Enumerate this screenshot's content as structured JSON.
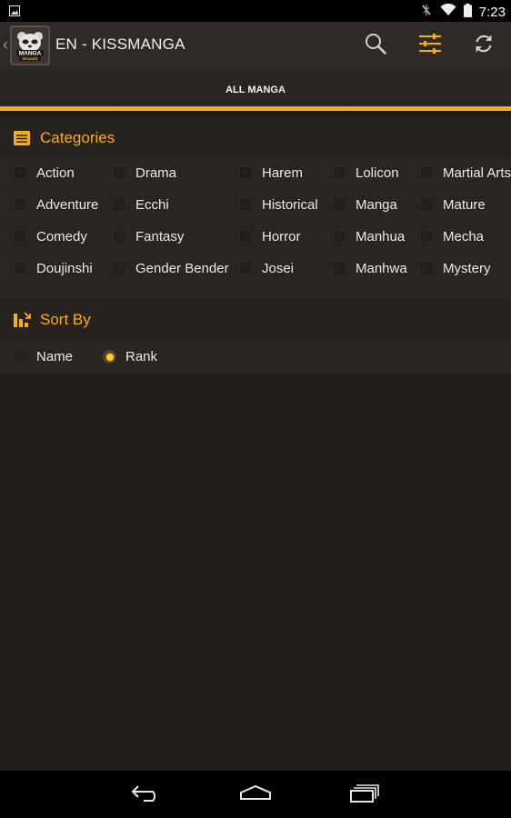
{
  "status_bar": {
    "time": "7:23",
    "icons": [
      "image-notification-icon",
      "signal-off-icon",
      "wifi-icon",
      "battery-icon"
    ]
  },
  "action_bar": {
    "title": "EN - KISSMANGA",
    "logo_text_top": "MANGA",
    "logo_text_bottom": "READER",
    "actions": [
      "search-icon",
      "filter-icon",
      "refresh-icon"
    ]
  },
  "tabs": [
    {
      "label": "ALL MANGA",
      "selected": true
    }
  ],
  "categories": {
    "title": "Categories",
    "columns": [
      [
        "Action",
        "Adventure",
        "Comedy",
        "Doujinshi"
      ],
      [
        "Drama",
        "Ecchi",
        "Fantasy",
        "Gender Bender"
      ],
      [
        "Harem",
        "Historical",
        "Horror",
        "Josei"
      ],
      [
        "Lolicon",
        "Manga",
        "Manhua",
        "Manhwa"
      ],
      [
        "Martial Arts",
        "Mature",
        "Mecha",
        "Mystery"
      ]
    ]
  },
  "sort_by": {
    "title": "Sort By",
    "options": [
      "Name",
      "Rank"
    ],
    "selected": "Rank"
  },
  "colors": {
    "accent": "#f6ad17",
    "background": "#221e1c",
    "action_bar": "#2f2927"
  },
  "nav_bar": [
    "back-icon",
    "home-icon",
    "recent-apps-icon"
  ]
}
